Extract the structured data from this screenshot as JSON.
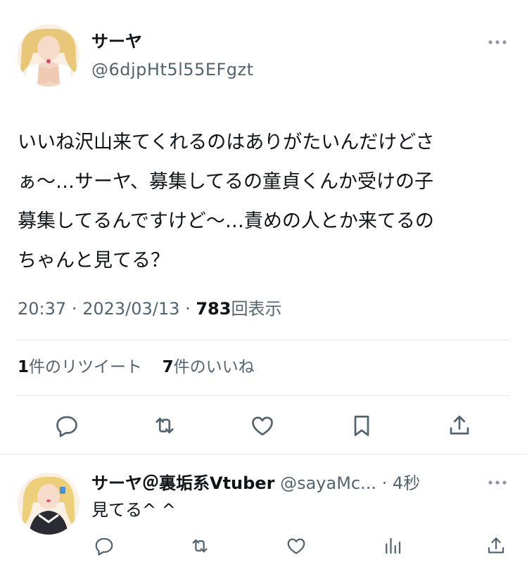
{
  "main_tweet": {
    "author_name": "サーヤ",
    "author_handle": "@6djpHt5l55EFgzt",
    "body_lines": [
      "いいね沢山来てくれるのはありがたいんだけどさ",
      "ぁ〜…サーヤ、募集してるの童貞くんか受けの子",
      "募集してるんですけど〜…責めの人とか来てるの",
      "ちゃんと見てる？"
    ],
    "time": "20:37",
    "sep1": "·",
    "date": "2023/03/13",
    "sep2": "·",
    "views_count": "783",
    "views_label": "回表示",
    "retweets_count": "1",
    "retweets_label": "件のリツイート",
    "likes_count": "7",
    "likes_label": "件のいいね"
  },
  "reply": {
    "author_name": "サーヤ＠裏垢系Vtuber",
    "author_handle": "@sayaMc...",
    "sep": "·",
    "time": "4秒",
    "text": "見てる^ ^"
  },
  "icons": {
    "more": "more-dots-icon",
    "reply": "reply-icon",
    "retweet": "retweet-icon",
    "like": "like-icon",
    "bookmark": "bookmark-icon",
    "share": "share-icon",
    "views": "views-icon"
  },
  "colors": {
    "text": "#0f1419",
    "secondary": "#536471",
    "divider": "#e6e9eb"
  }
}
